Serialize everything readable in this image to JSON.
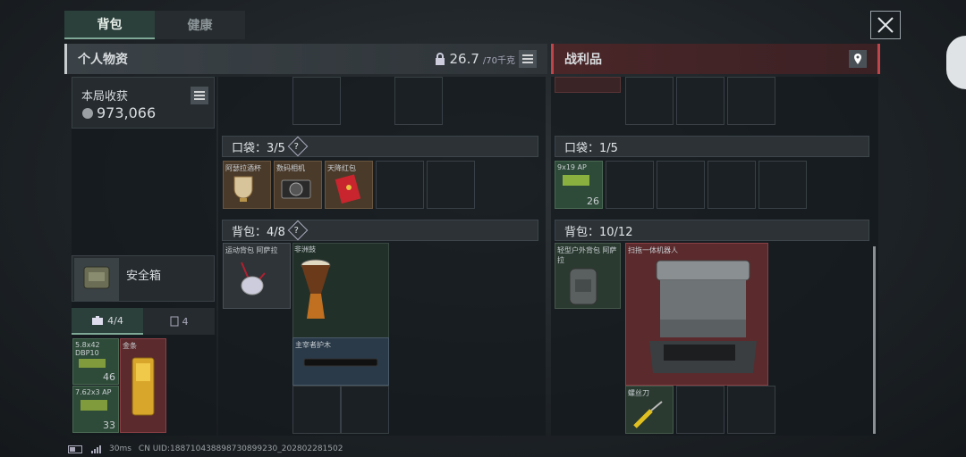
{
  "tabs": [
    {
      "label": "背包"
    },
    {
      "label": "健康"
    }
  ],
  "left_header": {
    "title": "个人物资",
    "weight": "26.7",
    "weight_cap": "/70千克"
  },
  "right_header": {
    "title": "战利品"
  },
  "earnings": {
    "label": "本局收获",
    "amount": "973,066"
  },
  "safebox": {
    "label": "安全箱",
    "tab1": "4/4",
    "tab2": "4"
  },
  "safe_items": [
    {
      "name": "5.8x42 DBP10",
      "count": "46"
    },
    {
      "name": "金条",
      "count": ""
    },
    {
      "name": "7.62x3 AP",
      "count": "33"
    }
  ],
  "pocket_left": {
    "label": "口袋：3/5",
    "items": [
      "阿瑟拉酒杯",
      "数码相机",
      "天降红包"
    ]
  },
  "backpack_left": {
    "label": "背包：4/8",
    "items": [
      "运动背包 阿萨拉",
      "非洲鼓",
      "主宰者护木"
    ]
  },
  "pocket_right": {
    "label": "口袋：1/5",
    "items": [
      {
        "name": "9x19 AP",
        "count": "26"
      }
    ]
  },
  "backpack_right": {
    "label": "背包：10/12",
    "items": [
      "轻型户外背包 阿萨拉",
      "扫拖一体机器人",
      "螺丝刀"
    ]
  },
  "status": {
    "ping": "30ms",
    "uid": "CN UID:1887104388987308992​30_202802281502"
  },
  "colors": {
    "loot_accent": "#c0454a",
    "tab_accent": "#7fa896"
  }
}
